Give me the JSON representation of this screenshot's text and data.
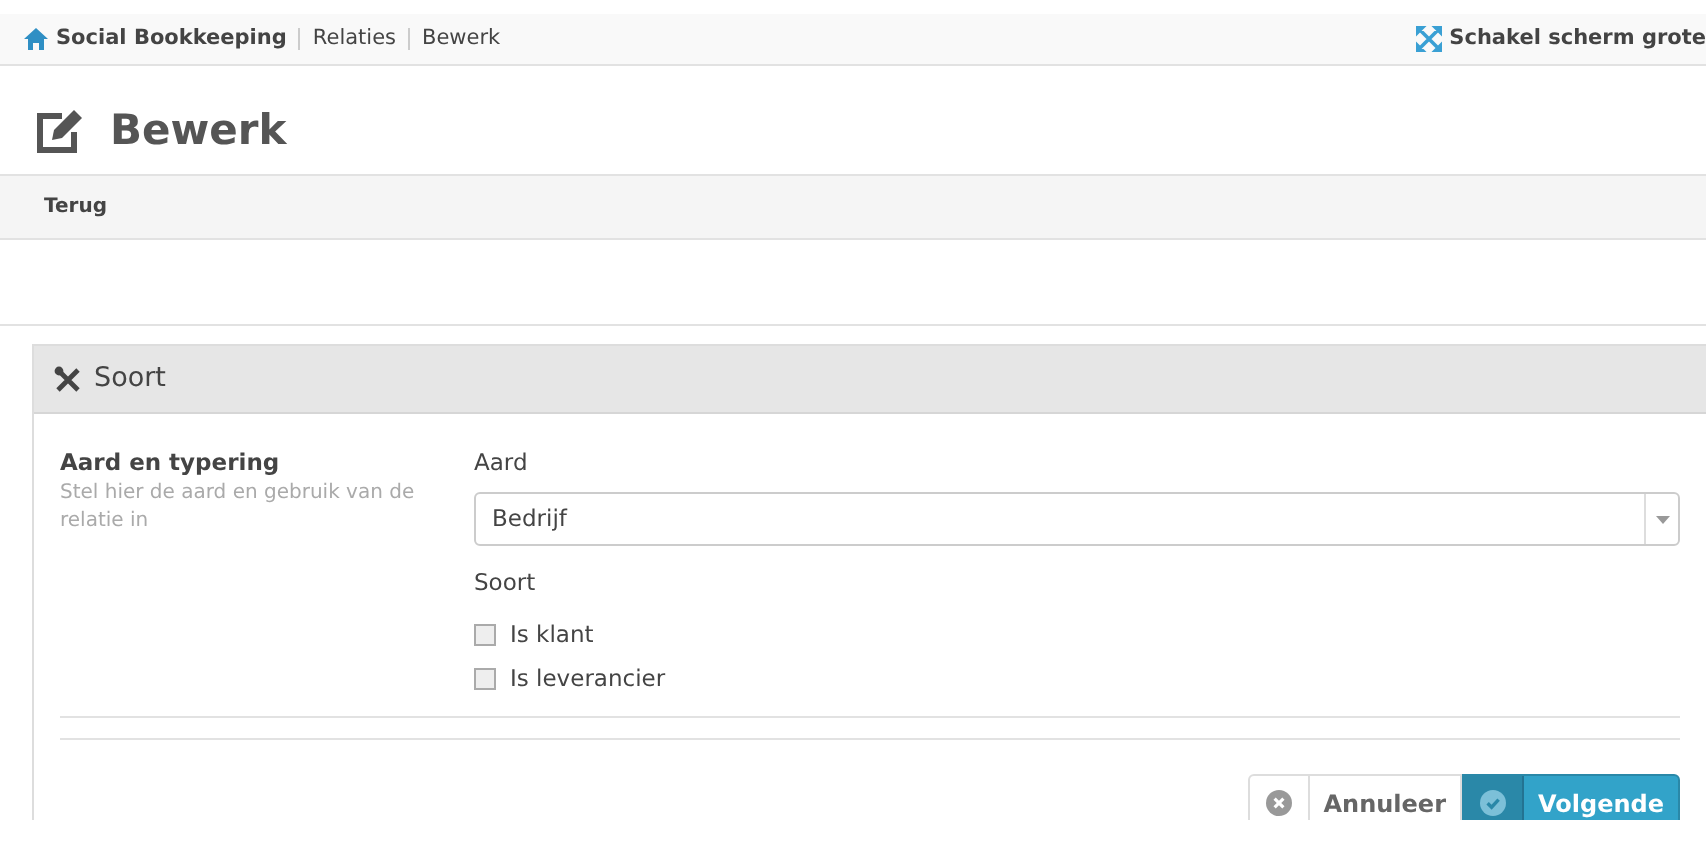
{
  "breadcrumb": [
    {
      "label": "Social Bookkeeping",
      "kind": "home"
    },
    {
      "label": "Relaties",
      "kind": "link"
    },
    {
      "label": "Bewerk",
      "kind": "current"
    }
  ],
  "toggle_screen": "Schakel scherm grote",
  "page_title": "Bewerk",
  "toolbar": {
    "back": "Terug"
  },
  "panel": {
    "title": "Soort",
    "section": {
      "title": "Aard en typering",
      "description": "Stel hier de aard en gebruik van de relatie in"
    },
    "aard": {
      "label": "Aard",
      "value": "Bedrijf"
    },
    "soort": {
      "label": "Soort",
      "options": [
        {
          "label": "Is klant",
          "checked": false
        },
        {
          "label": "Is leverancier",
          "checked": false
        }
      ]
    },
    "buttons": [
      {
        "label": "Annuleer",
        "kind": "cancel"
      },
      {
        "label": "Volgende",
        "kind": "next"
      }
    ]
  }
}
